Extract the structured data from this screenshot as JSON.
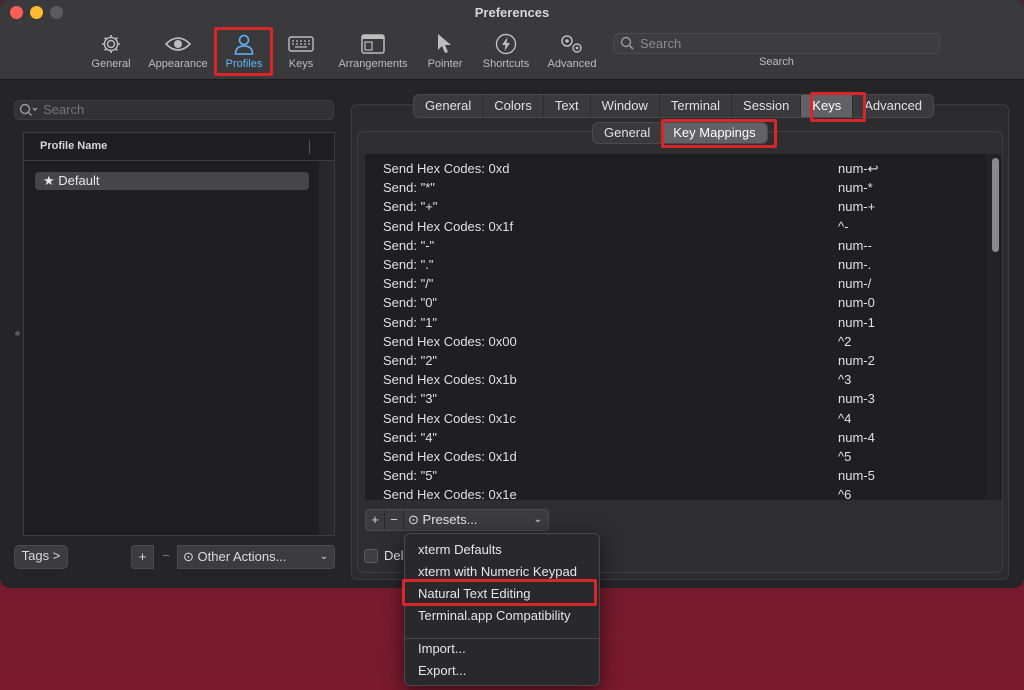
{
  "window": {
    "title": "Preferences"
  },
  "toolbar": {
    "items": [
      {
        "label": "General",
        "icon": "gear-icon"
      },
      {
        "label": "Appearance",
        "icon": "eye-icon"
      },
      {
        "label": "Profiles",
        "icon": "person-icon",
        "active": true
      },
      {
        "label": "Keys",
        "icon": "keyboard-icon"
      },
      {
        "label": "Arrangements",
        "icon": "window-icon"
      },
      {
        "label": "Pointer",
        "icon": "pointer-icon"
      },
      {
        "label": "Shortcuts",
        "icon": "lightning-icon"
      },
      {
        "label": "Advanced",
        "icon": "gears-icon"
      }
    ],
    "search_placeholder": "Search",
    "search_caption": "Search"
  },
  "sidebar": {
    "search_placeholder": "Search",
    "column_header": "Profile Name",
    "profiles": [
      {
        "name": "Default",
        "starred": true
      }
    ],
    "tags_button": "Tags >",
    "add_label": "+",
    "remove_label": "−",
    "other_actions": "Other Actions..."
  },
  "tabs": [
    "General",
    "Colors",
    "Text",
    "Window",
    "Terminal",
    "Session",
    "Keys",
    "Advanced"
  ],
  "selected_tab": "Keys",
  "subtabs": [
    "General",
    "Key Mappings"
  ],
  "selected_subtab": "Key Mappings",
  "mappings": [
    {
      "action": "Send Hex Codes: 0xd",
      "key": "num-↩"
    },
    {
      "action": "Send: \"*\"",
      "key": "num-*"
    },
    {
      "action": "Send: \"+\"",
      "key": "num-+"
    },
    {
      "action": "Send Hex Codes: 0x1f",
      "key": "^-"
    },
    {
      "action": "Send: \"-\"",
      "key": "num--"
    },
    {
      "action": "Send: \".\"",
      "key": "num-."
    },
    {
      "action": "Send: \"/\"",
      "key": "num-/"
    },
    {
      "action": "Send: \"0\"",
      "key": "num-0"
    },
    {
      "action": "Send: \"1\"",
      "key": "num-1"
    },
    {
      "action": "Send Hex Codes: 0x00",
      "key": "^2"
    },
    {
      "action": "Send: \"2\"",
      "key": "num-2"
    },
    {
      "action": "Send Hex Codes: 0x1b",
      "key": "^3"
    },
    {
      "action": "Send: \"3\"",
      "key": "num-3"
    },
    {
      "action": "Send Hex Codes: 0x1c",
      "key": "^4"
    },
    {
      "action": "Send: \"4\"",
      "key": "num-4"
    },
    {
      "action": "Send Hex Codes: 0x1d",
      "key": "^5"
    },
    {
      "action": "Send: \"5\"",
      "key": "num-5"
    },
    {
      "action": "Send Hex Codes: 0x1e",
      "key": "^6"
    }
  ],
  "mapping_controls": {
    "add_label": "+",
    "remove_label": "−",
    "presets_label": "Presets..."
  },
  "checkbox_label": "Del",
  "presets_menu": {
    "items": [
      "xterm Defaults",
      "xterm with Numeric Keypad",
      "Natural Text Editing",
      "Terminal.app Compatibility"
    ],
    "file_items": [
      "Import...",
      "Export..."
    ],
    "highlighted": "Natural Text Editing"
  },
  "colors": {
    "accent": "#62b5f7",
    "highlight_border": "#d8262b",
    "window_bg": "#252528",
    "titlebar_bg": "#3a393c"
  }
}
